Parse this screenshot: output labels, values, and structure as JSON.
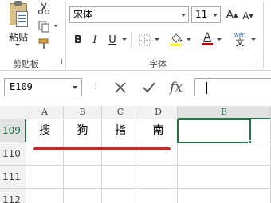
{
  "ribbon": {
    "clipboard": {
      "paste_label": "粘贴",
      "group_label": "剪贴板",
      "cut_icon": "scissors-icon",
      "copy_icon": "copy-icon",
      "format_painter_icon": "format-painter-icon"
    },
    "font": {
      "font_name": "宋体",
      "font_size": "11",
      "grow_label": "A",
      "shrink_label": "A",
      "bold": "B",
      "italic": "I",
      "underline": "U",
      "font_color_label": "A",
      "phonetic_top": "wén",
      "phonetic_bottom": "文",
      "group_label": "字体",
      "accent_red": "#c00000",
      "highlight_yellow": "#ffff00"
    }
  },
  "formula_bar": {
    "name_box": "E109",
    "cancel_icon": "cancel-x-icon",
    "enter_icon": "checkmark-icon",
    "fx_label": "fx",
    "content": ""
  },
  "sheet": {
    "columns": [
      "A",
      "B",
      "C",
      "D",
      "E"
    ],
    "selected_column": "E",
    "rows": [
      {
        "number": "109",
        "cells": [
          "搜",
          "狗",
          "指",
          "南",
          ""
        ]
      },
      {
        "number": "110",
        "cells": [
          "",
          "",
          "",
          "",
          ""
        ]
      },
      {
        "number": "111",
        "cells": [
          "",
          "",
          "",
          "",
          ""
        ]
      },
      {
        "number": "112",
        "cells": [
          "",
          "",
          "",
          "",
          ""
        ]
      }
    ],
    "active_cell": "E109",
    "accent_green": "#217346",
    "annotation_color": "#c8282a"
  }
}
